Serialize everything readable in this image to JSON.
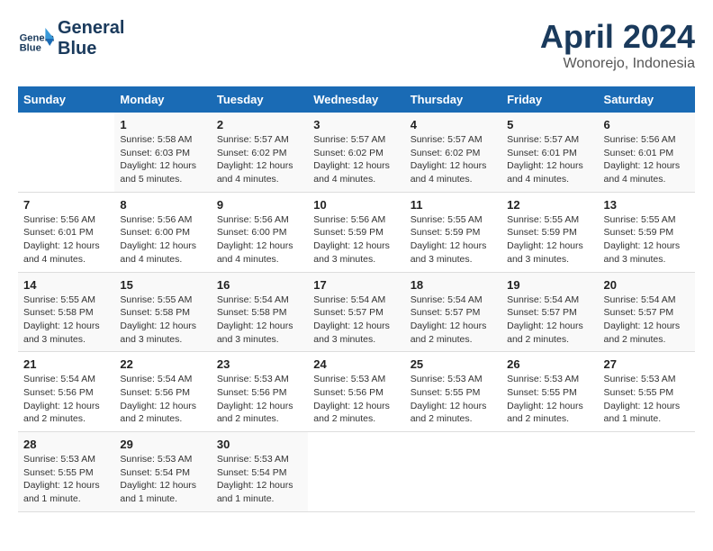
{
  "header": {
    "logo_line1": "General",
    "logo_line2": "Blue",
    "month_year": "April 2024",
    "location": "Wonorejo, Indonesia"
  },
  "weekdays": [
    "Sunday",
    "Monday",
    "Tuesday",
    "Wednesday",
    "Thursday",
    "Friday",
    "Saturday"
  ],
  "weeks": [
    [
      {
        "day": "",
        "sunrise": "",
        "sunset": "",
        "daylight": ""
      },
      {
        "day": "1",
        "sunrise": "Sunrise: 5:58 AM",
        "sunset": "Sunset: 6:03 PM",
        "daylight": "Daylight: 12 hours and 5 minutes."
      },
      {
        "day": "2",
        "sunrise": "Sunrise: 5:57 AM",
        "sunset": "Sunset: 6:02 PM",
        "daylight": "Daylight: 12 hours and 4 minutes."
      },
      {
        "day": "3",
        "sunrise": "Sunrise: 5:57 AM",
        "sunset": "Sunset: 6:02 PM",
        "daylight": "Daylight: 12 hours and 4 minutes."
      },
      {
        "day": "4",
        "sunrise": "Sunrise: 5:57 AM",
        "sunset": "Sunset: 6:02 PM",
        "daylight": "Daylight: 12 hours and 4 minutes."
      },
      {
        "day": "5",
        "sunrise": "Sunrise: 5:57 AM",
        "sunset": "Sunset: 6:01 PM",
        "daylight": "Daylight: 12 hours and 4 minutes."
      },
      {
        "day": "6",
        "sunrise": "Sunrise: 5:56 AM",
        "sunset": "Sunset: 6:01 PM",
        "daylight": "Daylight: 12 hours and 4 minutes."
      }
    ],
    [
      {
        "day": "7",
        "sunrise": "Sunrise: 5:56 AM",
        "sunset": "Sunset: 6:01 PM",
        "daylight": "Daylight: 12 hours and 4 minutes."
      },
      {
        "day": "8",
        "sunrise": "Sunrise: 5:56 AM",
        "sunset": "Sunset: 6:00 PM",
        "daylight": "Daylight: 12 hours and 4 minutes."
      },
      {
        "day": "9",
        "sunrise": "Sunrise: 5:56 AM",
        "sunset": "Sunset: 6:00 PM",
        "daylight": "Daylight: 12 hours and 4 minutes."
      },
      {
        "day": "10",
        "sunrise": "Sunrise: 5:56 AM",
        "sunset": "Sunset: 5:59 PM",
        "daylight": "Daylight: 12 hours and 3 minutes."
      },
      {
        "day": "11",
        "sunrise": "Sunrise: 5:55 AM",
        "sunset": "Sunset: 5:59 PM",
        "daylight": "Daylight: 12 hours and 3 minutes."
      },
      {
        "day": "12",
        "sunrise": "Sunrise: 5:55 AM",
        "sunset": "Sunset: 5:59 PM",
        "daylight": "Daylight: 12 hours and 3 minutes."
      },
      {
        "day": "13",
        "sunrise": "Sunrise: 5:55 AM",
        "sunset": "Sunset: 5:59 PM",
        "daylight": "Daylight: 12 hours and 3 minutes."
      }
    ],
    [
      {
        "day": "14",
        "sunrise": "Sunrise: 5:55 AM",
        "sunset": "Sunset: 5:58 PM",
        "daylight": "Daylight: 12 hours and 3 minutes."
      },
      {
        "day": "15",
        "sunrise": "Sunrise: 5:55 AM",
        "sunset": "Sunset: 5:58 PM",
        "daylight": "Daylight: 12 hours and 3 minutes."
      },
      {
        "day": "16",
        "sunrise": "Sunrise: 5:54 AM",
        "sunset": "Sunset: 5:58 PM",
        "daylight": "Daylight: 12 hours and 3 minutes."
      },
      {
        "day": "17",
        "sunrise": "Sunrise: 5:54 AM",
        "sunset": "Sunset: 5:57 PM",
        "daylight": "Daylight: 12 hours and 3 minutes."
      },
      {
        "day": "18",
        "sunrise": "Sunrise: 5:54 AM",
        "sunset": "Sunset: 5:57 PM",
        "daylight": "Daylight: 12 hours and 2 minutes."
      },
      {
        "day": "19",
        "sunrise": "Sunrise: 5:54 AM",
        "sunset": "Sunset: 5:57 PM",
        "daylight": "Daylight: 12 hours and 2 minutes."
      },
      {
        "day": "20",
        "sunrise": "Sunrise: 5:54 AM",
        "sunset": "Sunset: 5:57 PM",
        "daylight": "Daylight: 12 hours and 2 minutes."
      }
    ],
    [
      {
        "day": "21",
        "sunrise": "Sunrise: 5:54 AM",
        "sunset": "Sunset: 5:56 PM",
        "daylight": "Daylight: 12 hours and 2 minutes."
      },
      {
        "day": "22",
        "sunrise": "Sunrise: 5:54 AM",
        "sunset": "Sunset: 5:56 PM",
        "daylight": "Daylight: 12 hours and 2 minutes."
      },
      {
        "day": "23",
        "sunrise": "Sunrise: 5:53 AM",
        "sunset": "Sunset: 5:56 PM",
        "daylight": "Daylight: 12 hours and 2 minutes."
      },
      {
        "day": "24",
        "sunrise": "Sunrise: 5:53 AM",
        "sunset": "Sunset: 5:56 PM",
        "daylight": "Daylight: 12 hours and 2 minutes."
      },
      {
        "day": "25",
        "sunrise": "Sunrise: 5:53 AM",
        "sunset": "Sunset: 5:55 PM",
        "daylight": "Daylight: 12 hours and 2 minutes."
      },
      {
        "day": "26",
        "sunrise": "Sunrise: 5:53 AM",
        "sunset": "Sunset: 5:55 PM",
        "daylight": "Daylight: 12 hours and 2 minutes."
      },
      {
        "day": "27",
        "sunrise": "Sunrise: 5:53 AM",
        "sunset": "Sunset: 5:55 PM",
        "daylight": "Daylight: 12 hours and 1 minute."
      }
    ],
    [
      {
        "day": "28",
        "sunrise": "Sunrise: 5:53 AM",
        "sunset": "Sunset: 5:55 PM",
        "daylight": "Daylight: 12 hours and 1 minute."
      },
      {
        "day": "29",
        "sunrise": "Sunrise: 5:53 AM",
        "sunset": "Sunset: 5:54 PM",
        "daylight": "Daylight: 12 hours and 1 minute."
      },
      {
        "day": "30",
        "sunrise": "Sunrise: 5:53 AM",
        "sunset": "Sunset: 5:54 PM",
        "daylight": "Daylight: 12 hours and 1 minute."
      },
      {
        "day": "",
        "sunrise": "",
        "sunset": "",
        "daylight": ""
      },
      {
        "day": "",
        "sunrise": "",
        "sunset": "",
        "daylight": ""
      },
      {
        "day": "",
        "sunrise": "",
        "sunset": "",
        "daylight": ""
      },
      {
        "day": "",
        "sunrise": "",
        "sunset": "",
        "daylight": ""
      }
    ]
  ]
}
